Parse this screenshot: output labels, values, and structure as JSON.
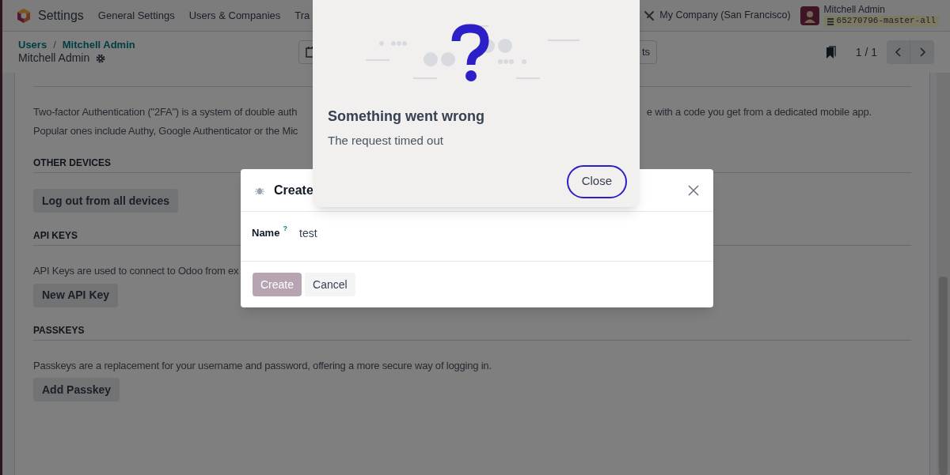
{
  "navbar": {
    "app_name": "Settings",
    "menu": [
      "General Settings",
      "Users & Companies",
      "Tra"
    ],
    "company": "My Company (San Francisco)",
    "user": {
      "name": "Mitchell Admin",
      "database": "65270796-master-all"
    }
  },
  "control_panel": {
    "breadcrumb": [
      "Users",
      "Mitchell Admin"
    ],
    "breadcrumb_separator": "/",
    "record_title": "Mitchell Admin",
    "action_button": "ts",
    "pager": "1 / 1"
  },
  "two_factor": {
    "lines": [
      {
        "start": "Two-factor Authentication (\"2FA\") is a system of double auth",
        "end": "e with a code you get from a dedicated mobile app."
      },
      {
        "start": "Popular ones include Authy, Google Authenticator or the Mic"
      }
    ]
  },
  "sections": [
    {
      "title": "OTHER DEVICES",
      "button": "Log out from all devices"
    },
    {
      "title": "API KEYS",
      "text": "API Keys are used to connect to Odoo from ex",
      "button": "New API Key"
    },
    {
      "title": "PASSKEYS",
      "text": "Passkeys are a replacement for your username and password, offering a more secure way of logging in.",
      "button": "Add Passkey"
    }
  ],
  "create_dialog": {
    "title": "Create",
    "fields": [
      {
        "label": "Name",
        "help": "?",
        "value": "test"
      }
    ],
    "buttons": [
      {
        "label": "Create",
        "kind": "primary",
        "disabled": true
      },
      {
        "label": "Cancel",
        "kind": "secondary",
        "disabled": false
      }
    ]
  },
  "error_dialog": {
    "title": "Something went wrong",
    "message": "The request timed out",
    "button": "Close"
  }
}
